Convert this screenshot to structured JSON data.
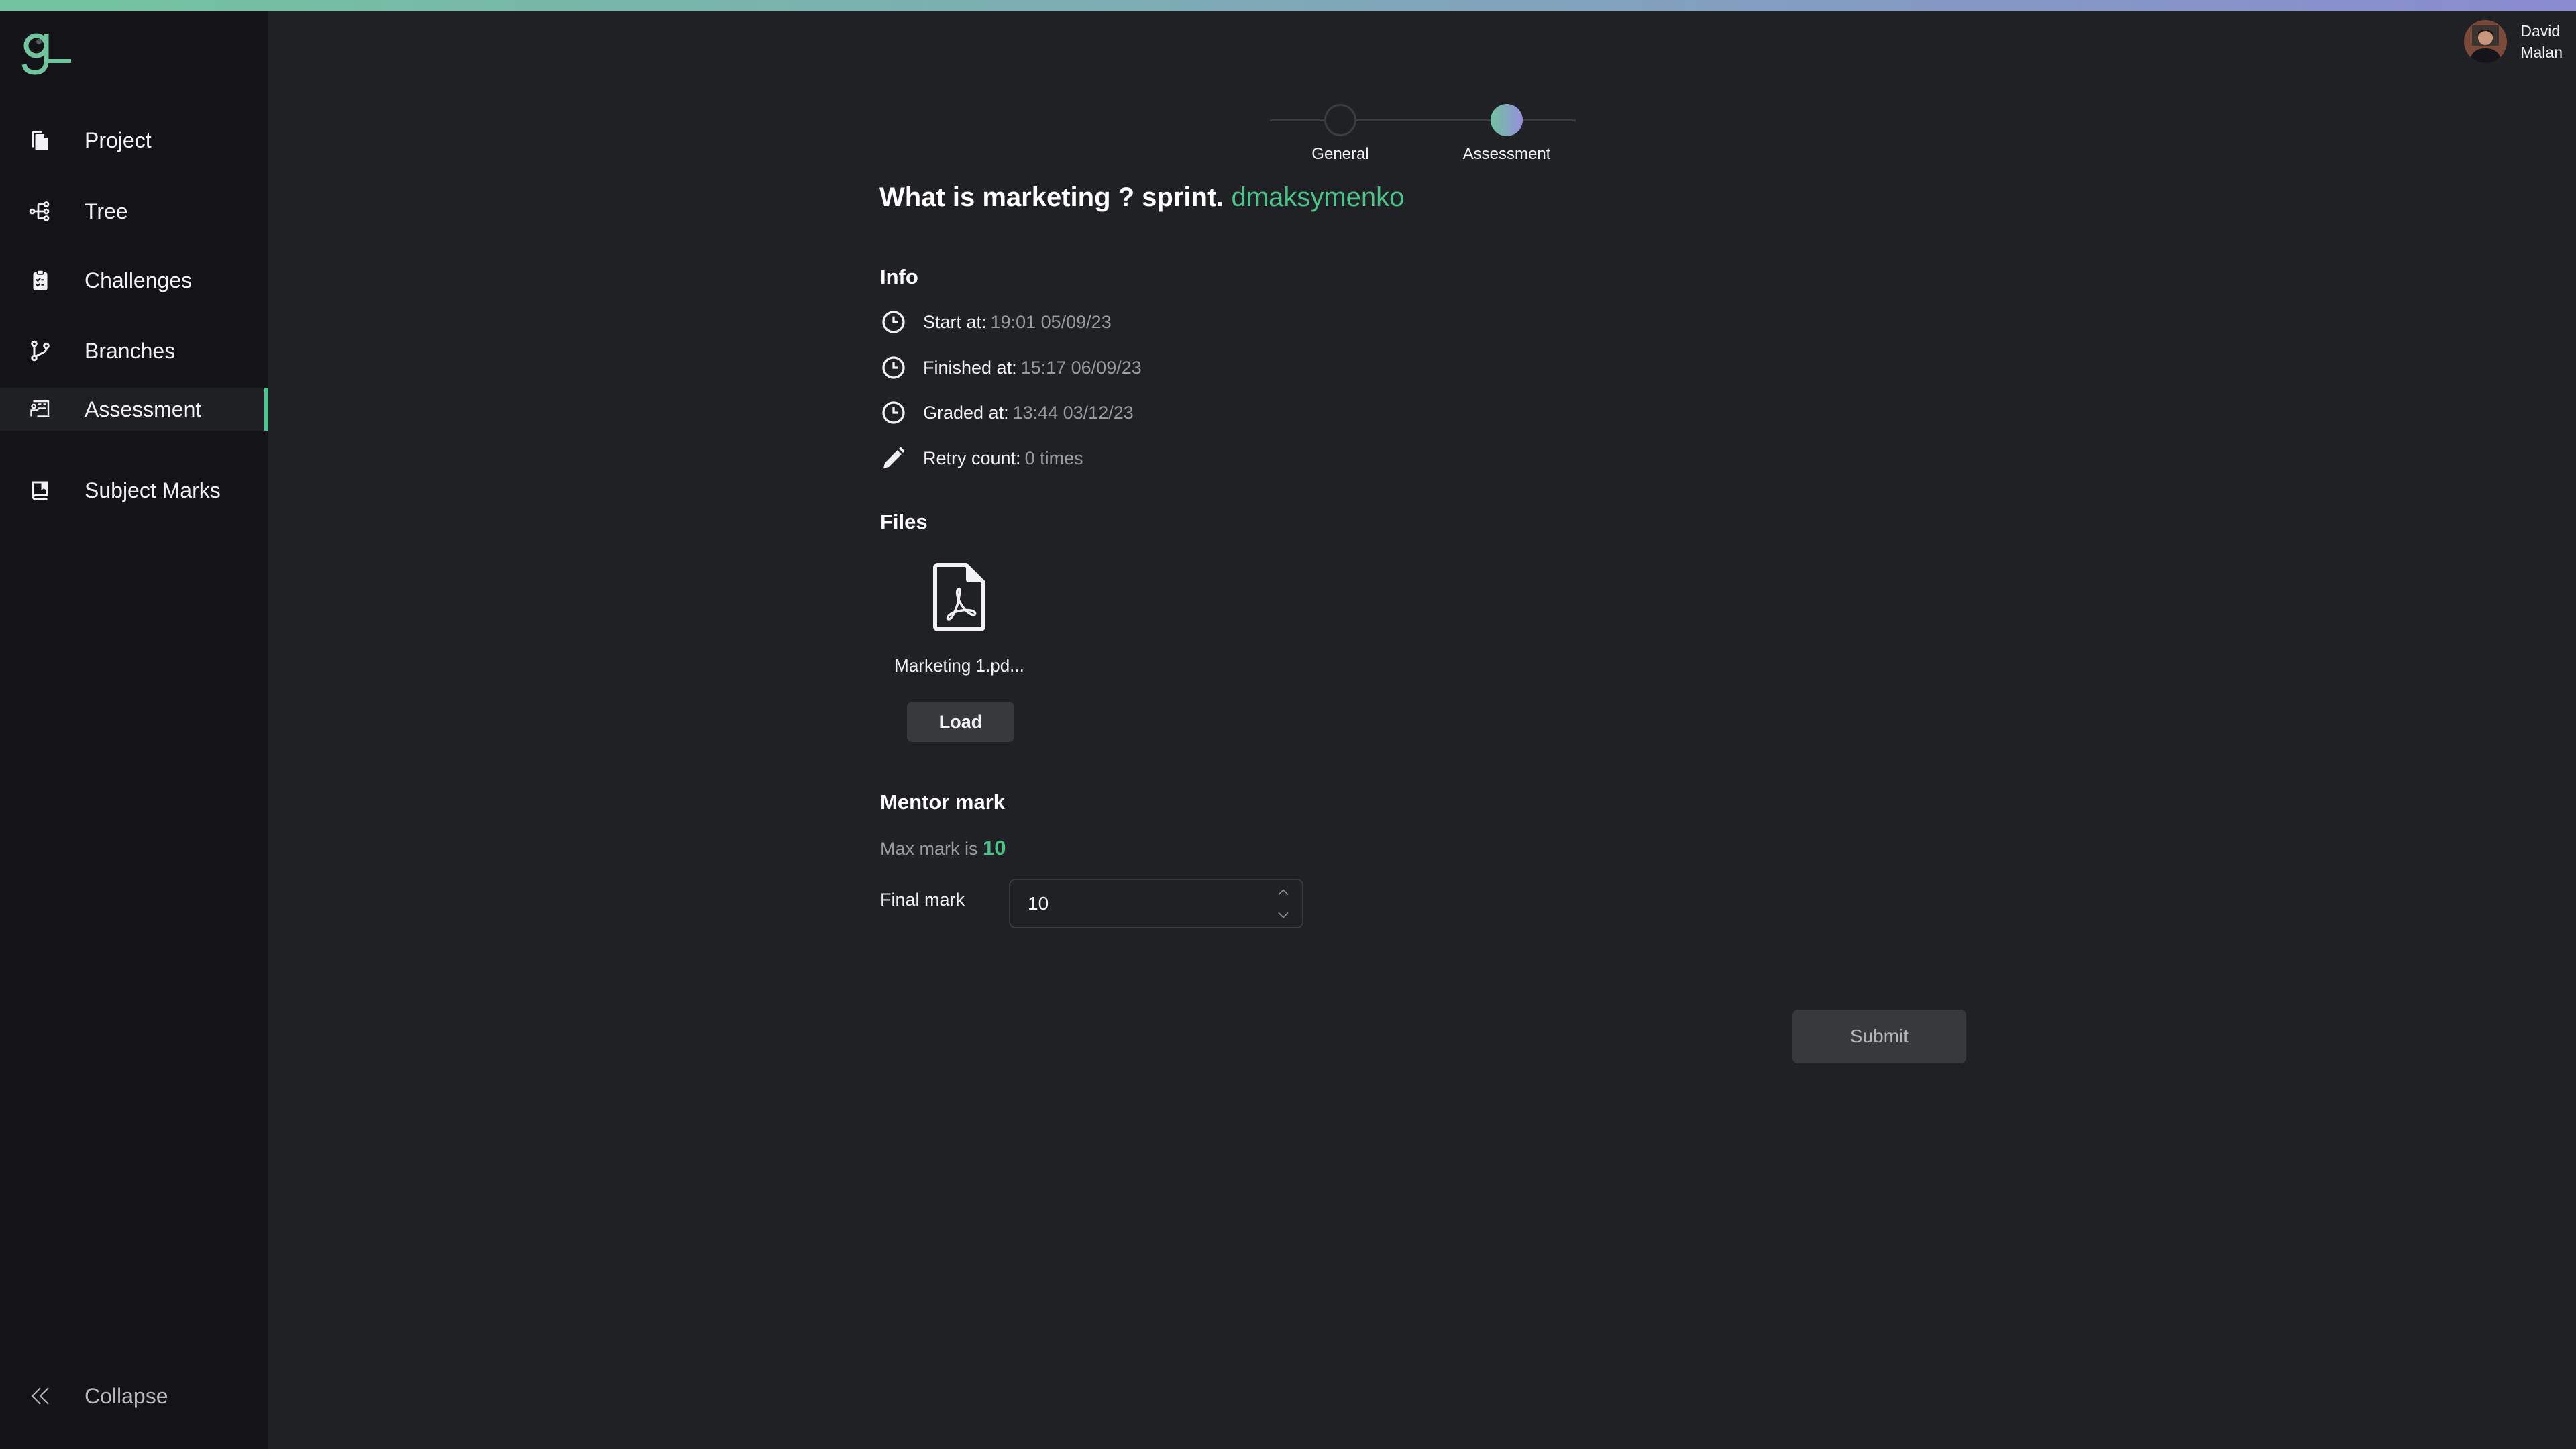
{
  "app": {
    "brand_color": "#4cc38a",
    "gradient_start": "#72c49e",
    "gradient_end": "#8a8bd0"
  },
  "sidebar": {
    "logo": "g-logo-icon",
    "items": [
      {
        "label": "Project",
        "icon": "files-icon",
        "active": false
      },
      {
        "label": "Tree",
        "icon": "tree-icon",
        "active": false
      },
      {
        "label": "Challenges",
        "icon": "clipboard-checklist-icon",
        "active": false
      },
      {
        "label": "Branches",
        "icon": "git-branch-icon",
        "active": false
      },
      {
        "label": "Assessment",
        "icon": "presentation-icon",
        "active": true
      },
      {
        "label": "Subject Marks",
        "icon": "book-icon",
        "active": false
      }
    ],
    "collapse_label": "Collapse"
  },
  "user": {
    "first_name": "David",
    "last_name": "Malan"
  },
  "stepper": {
    "steps": [
      {
        "label": "General",
        "active": false
      },
      {
        "label": "Assessment",
        "active": true
      }
    ]
  },
  "header": {
    "title": "What is marketing ? sprint.",
    "username": "dmaksymenko"
  },
  "info": {
    "heading": "Info",
    "rows": [
      {
        "icon": "clock-icon",
        "label": "Start at:",
        "value": "19:01 05/09/23"
      },
      {
        "icon": "clock-icon",
        "label": "Finished at:",
        "value": "15:17 06/09/23"
      },
      {
        "icon": "clock-icon",
        "label": "Graded at:",
        "value": "13:44 03/12/23"
      },
      {
        "icon": "pencil-icon",
        "label": "Retry count:",
        "value": "0 times"
      }
    ]
  },
  "files": {
    "heading": "Files",
    "items": [
      {
        "name": "Marketing 1.pd...",
        "icon": "pdf-file-icon",
        "button_label": "Load"
      }
    ]
  },
  "mentor_mark": {
    "heading": "Mentor mark",
    "max_mark_prefix": "Max mark is",
    "max_mark": "10",
    "final_mark_label": "Final mark",
    "final_mark_value": "10"
  },
  "actions": {
    "submit_label": "Submit"
  }
}
